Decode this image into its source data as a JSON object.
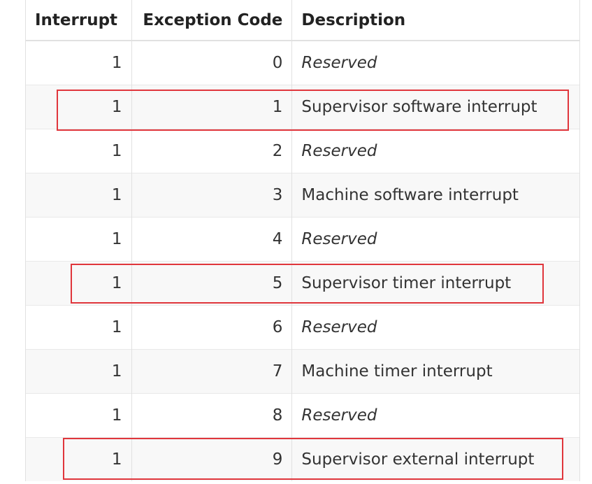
{
  "table": {
    "headers": {
      "interrupt": "Interrupt",
      "exception_code": "Exception Code",
      "description": "Description"
    },
    "rows": [
      {
        "interrupt": "1",
        "code": "0",
        "description": "Reserved",
        "italic": true
      },
      {
        "interrupt": "1",
        "code": "1",
        "description": "Supervisor software interrupt",
        "italic": false,
        "highlighted": true
      },
      {
        "interrupt": "1",
        "code": "2",
        "description": "Reserved",
        "italic": true
      },
      {
        "interrupt": "1",
        "code": "3",
        "description": "Machine software interrupt",
        "italic": false
      },
      {
        "interrupt": "1",
        "code": "4",
        "description": "Reserved",
        "italic": true
      },
      {
        "interrupt": "1",
        "code": "5",
        "description": "Supervisor timer interrupt",
        "italic": false,
        "highlighted": true
      },
      {
        "interrupt": "1",
        "code": "6",
        "description": "Reserved",
        "italic": true
      },
      {
        "interrupt": "1",
        "code": "7",
        "description": "Machine timer interrupt",
        "italic": false
      },
      {
        "interrupt": "1",
        "code": "8",
        "description": "Reserved",
        "italic": true
      },
      {
        "interrupt": "1",
        "code": "9",
        "description": "Supervisor external interrupt",
        "italic": false,
        "highlighted": true
      }
    ]
  },
  "colors": {
    "highlight_border": "#e0363c",
    "even_row_bg": "#f8f8f8",
    "grid": "#e1e1e1"
  }
}
